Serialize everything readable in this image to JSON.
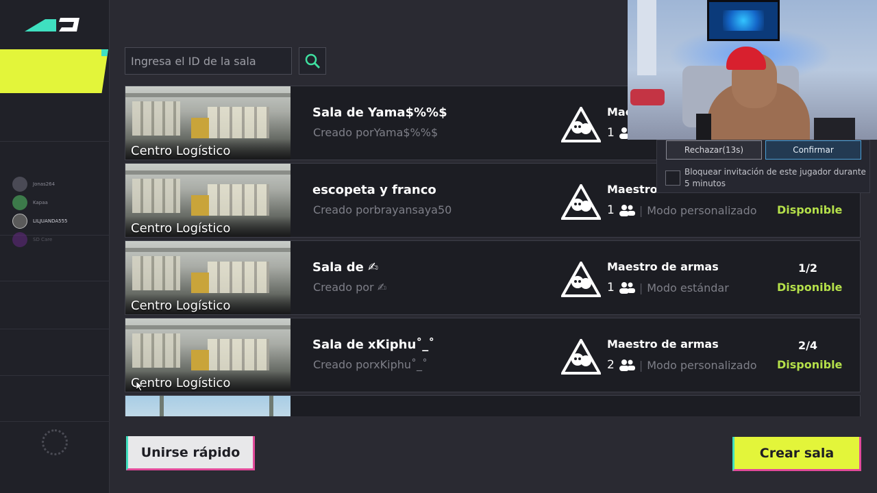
{
  "search": {
    "placeholder": "Ingresa el ID de la sala",
    "button_icon": "search-icon"
  },
  "sidebar": {
    "friends": [
      {
        "name": "Jonas264"
      },
      {
        "name": "Kapaa"
      },
      {
        "name": "LILJUANDA555"
      },
      {
        "name": "SD Care"
      }
    ]
  },
  "rooms": [
    {
      "map": "Centro Logístico",
      "name": "Sala de Yama$%%$",
      "creator": "Creado porYama$%%$",
      "mode": "Mae",
      "players": "1",
      "submode": "",
      "slots": "",
      "status": ""
    },
    {
      "map": "Centro Logístico",
      "name": "escopeta y franco",
      "creator": "Creado porbrayansaya50",
      "mode": "Maestro",
      "players": "1",
      "submode": "Modo personalizado",
      "slots": "",
      "status": "Disponible"
    },
    {
      "map": "Centro Logístico",
      "name": "Sala de ✍",
      "creator": "Creado por ✍",
      "mode": "Maestro de armas",
      "players": "1",
      "submode": "Modo estándar",
      "slots": "1/2",
      "status": "Disponible"
    },
    {
      "map": "Centro Logístico",
      "name": "Sala de xKiphu˚_˚",
      "creator": "Creado porxKiphu˚_˚",
      "mode": "Maestro de armas",
      "players": "2",
      "submode": "Modo personalizado",
      "slots": "2/4",
      "status": "Disponible"
    },
    {
      "map": "",
      "name": "",
      "creator": "",
      "mode": "",
      "players": "",
      "submode": "",
      "slots": "",
      "status": ""
    }
  ],
  "buttons": {
    "quick_join": "Unirse rápido",
    "create_room": "Crear sala"
  },
  "invite": {
    "reject": "Rechazar(13s)",
    "confirm": "Confirmar",
    "block_text": "Bloquear invitación de este jugador durante 5 minutos"
  },
  "colors": {
    "accent_yellow": "#e3f53a",
    "status_green": "#b5e04a",
    "accent_teal": "#3fe0c0",
    "accent_pink": "#e24a9a"
  }
}
